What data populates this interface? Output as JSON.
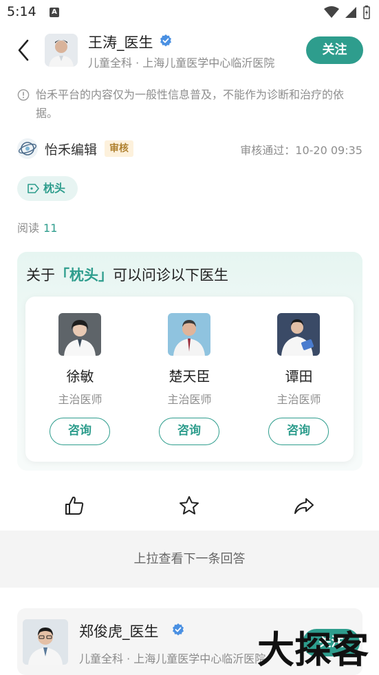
{
  "status_bar": {
    "time": "5:14",
    "notification_glyph": "A"
  },
  "header": {
    "doctor_name": "王涛_医生",
    "doctor_subtitle": "儿童全科 · 上海儿童医学中心临沂医院",
    "follow_label": "关注"
  },
  "disclaimer": {
    "text": "怡禾平台的内容仅为一般性信息普及，不能作为诊断和治疗的依据。"
  },
  "editor": {
    "name": "怡禾编辑",
    "badge": "审核",
    "review_time": "审核通过：10-20 09:35"
  },
  "tag": {
    "label": "枕头"
  },
  "reads": {
    "label": "阅读",
    "count": "11"
  },
  "consult": {
    "title_prefix": "关于",
    "title_topic": "「枕头」",
    "title_suffix": "可以问诊以下医生",
    "doctors": [
      {
        "name": "徐敏",
        "title": "主治医师",
        "button": "咨询"
      },
      {
        "name": "楚天臣",
        "title": "主治医师",
        "button": "咨询"
      },
      {
        "name": "谭田",
        "title": "主治医师",
        "button": "咨询"
      }
    ]
  },
  "actions": {
    "like_icon": "thumbs-up-icon",
    "favorite_icon": "star-icon",
    "share_icon": "share-icon"
  },
  "next_answer": {
    "label": "上拉查看下一条回答"
  },
  "next_card": {
    "doctor_name": "郑俊虎_医生",
    "doctor_subtitle": "儿童全科 · 上海儿童医学中心临沂医院",
    "follow_label": "关注"
  },
  "watermark": {
    "text": "大探客"
  },
  "colors": {
    "accent": "#2e9d8d",
    "verified": "#4a90e2",
    "badge_bg": "#fdf1dc",
    "badge_text": "#b08231"
  }
}
